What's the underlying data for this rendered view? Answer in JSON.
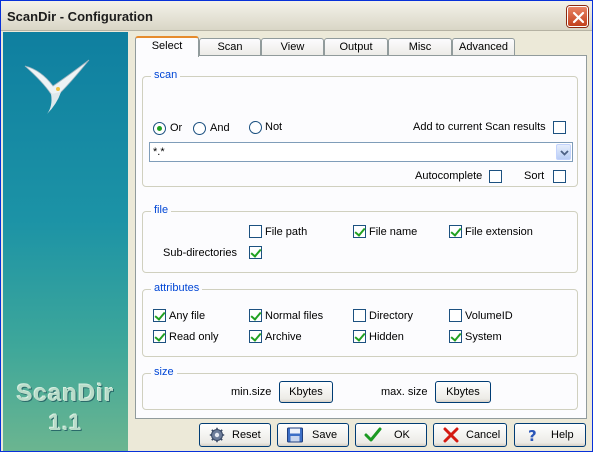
{
  "window": {
    "title": "ScanDir - Configuration"
  },
  "sidebar": {
    "brand": "ScanDir",
    "version": "1.1"
  },
  "tabs": [
    "Select",
    "Scan",
    "View",
    "Output",
    "Misc",
    "Advanced"
  ],
  "active_tab": "Select",
  "scan": {
    "legend": "scan",
    "radios": [
      {
        "label": "Or",
        "checked": true
      },
      {
        "label": "And",
        "checked": false
      },
      {
        "label": "Not",
        "checked": false
      }
    ],
    "add_to_results": {
      "label": "Add to current Scan results",
      "checked": false
    },
    "pattern": "*.*",
    "autocomplete": {
      "label": "Autocomplete",
      "checked": false
    },
    "sort": {
      "label": "Sort",
      "checked": false
    }
  },
  "file": {
    "legend": "file",
    "file_path": {
      "label": "File path",
      "checked": false
    },
    "file_name": {
      "label": "File name",
      "checked": true
    },
    "file_extension": {
      "label": "File extension",
      "checked": true
    },
    "sub_directories": {
      "label": "Sub-directories",
      "checked": true
    }
  },
  "attributes": {
    "legend": "attributes",
    "items": [
      {
        "label": "Any file",
        "checked": true
      },
      {
        "label": "Normal files",
        "checked": true
      },
      {
        "label": "Directory",
        "checked": false
      },
      {
        "label": "VolumeID",
        "checked": false
      },
      {
        "label": "Read only",
        "checked": true
      },
      {
        "label": "Archive",
        "checked": true
      },
      {
        "label": "Hidden",
        "checked": true
      },
      {
        "label": "System",
        "checked": true
      }
    ]
  },
  "size": {
    "legend": "size",
    "min_label": "min.size",
    "min_unit": "Kbytes",
    "max_label": "max. size",
    "max_unit": "Kbytes"
  },
  "footer": {
    "reset": "Reset",
    "save": "Save",
    "ok": "OK",
    "cancel": "Cancel",
    "help": "Help"
  }
}
